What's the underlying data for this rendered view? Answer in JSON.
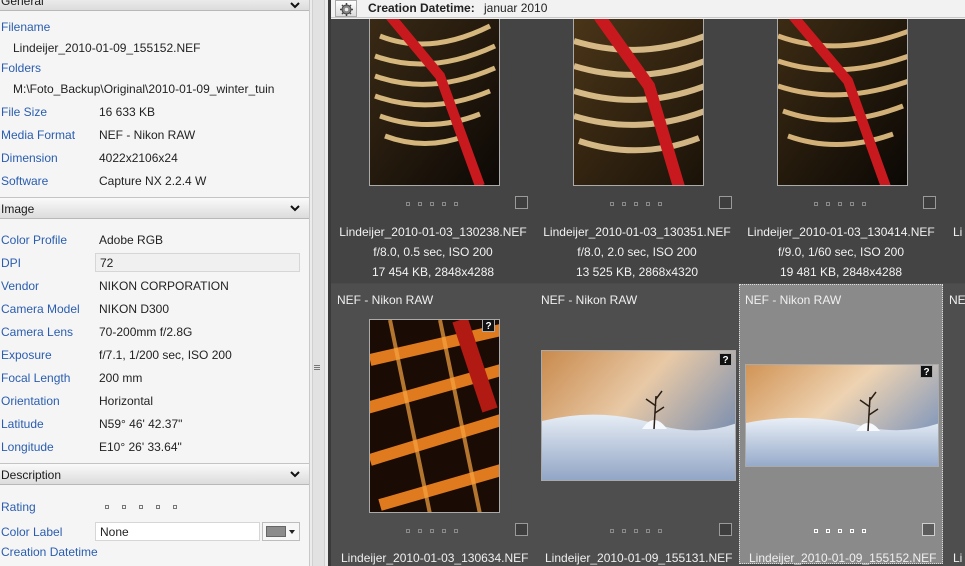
{
  "left_panel": {
    "general": {
      "header": "General",
      "filename_label": "Filename",
      "filename_value": "Lindeijer_2010-01-09_155152.NEF",
      "folders_label": "Folders",
      "folders_value": "M:\\Foto_Backup\\Original\\2010-01-09_winter_tuin",
      "rows": [
        {
          "label": "File Size",
          "value": "16 633 KB"
        },
        {
          "label": "Media Format",
          "value": "NEF - Nikon RAW"
        },
        {
          "label": "Dimension",
          "value": "4022x2106x24"
        },
        {
          "label": "Software",
          "value": "Capture NX 2.2.4 W"
        }
      ]
    },
    "image": {
      "header": "Image",
      "rows": [
        {
          "label": "Color Profile",
          "value": "Adobe RGB"
        },
        {
          "label": "DPI",
          "value": "72"
        },
        {
          "label": "Vendor",
          "value": "NIKON CORPORATION"
        },
        {
          "label": "Camera Model",
          "value": "NIKON D300"
        },
        {
          "label": "Camera Lens",
          "value": "70-200mm f/2.8G"
        },
        {
          "label": "Exposure",
          "value": "f/7.1, 1/200 sec, ISO 200"
        },
        {
          "label": "Focal Length",
          "value": "200 mm"
        },
        {
          "label": "Orientation",
          "value": "Horizontal"
        },
        {
          "label": "Latitude",
          "value": "N59° 46' 42.37\""
        },
        {
          "label": "Longitude",
          "value": "E10° 26' 33.64\""
        }
      ]
    },
    "description": {
      "header": "Description",
      "rating_label": "Rating",
      "rating_value": 0,
      "color_label_label": "Color Label",
      "color_label_value": "None",
      "color_label_swatch": "#8c8c8c",
      "creation_label": "Creation Datetime"
    }
  },
  "topbar": {
    "icon": "gear-icon",
    "creation_label": "Creation Datetime:",
    "creation_value": "januar 2010"
  },
  "grid": {
    "row1": [
      {
        "filename": "Lindeijer_2010-01-03_130238.NEF",
        "exposure": "f/8.0, 0.5 sec, ISO 200",
        "info": "17 454 KB, 2848x4288"
      },
      {
        "filename": "Lindeijer_2010-01-03_130351.NEF",
        "exposure": "f/8.0, 2.0 sec, ISO 200",
        "info": "13 525 KB, 2868x4320"
      },
      {
        "filename": "Lindeijer_2010-01-03_130414.NEF",
        "exposure": "f/9.0, 1/60 sec, ISO 200",
        "info": "19 481 KB, 2848x4288"
      }
    ],
    "row1_partial": "Li",
    "row2": [
      {
        "format": "NEF - Nikon RAW",
        "badge": "?",
        "filename": "Lindeijer_2010-01-03_130634.NEF"
      },
      {
        "format": "NEF - Nikon RAW",
        "badge": "?",
        "filename": "Lindeijer_2010-01-09_155131.NEF"
      },
      {
        "format": "NEF - Nikon RAW",
        "badge": "?",
        "filename": "Lindeijer_2010-01-09_155152.NEF"
      }
    ],
    "row2_partial": "NE",
    "row2_partial_bottom": "Li"
  }
}
